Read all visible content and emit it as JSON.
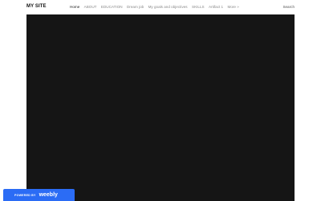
{
  "header": {
    "site_title": "MY SITE",
    "nav": [
      {
        "label": "Home",
        "active": true
      },
      {
        "label": "ABOUT",
        "active": false
      },
      {
        "label": "EDUCATION",
        "active": false
      },
      {
        "label": "Dream job",
        "active": false
      },
      {
        "label": "My goals and objectives",
        "active": false
      },
      {
        "label": "SKILLS",
        "active": false
      },
      {
        "label": "Artifact 1",
        "active": false
      },
      {
        "label": "More »",
        "active": false
      }
    ],
    "search_label": "Search"
  },
  "badge": {
    "powered_by": "POWERED BY",
    "brand": "weebly",
    "color": "#2b6cf5"
  },
  "colors": {
    "hero_background": "#151515",
    "nav_active": "#222222",
    "nav_inactive": "#8a8a8a"
  }
}
